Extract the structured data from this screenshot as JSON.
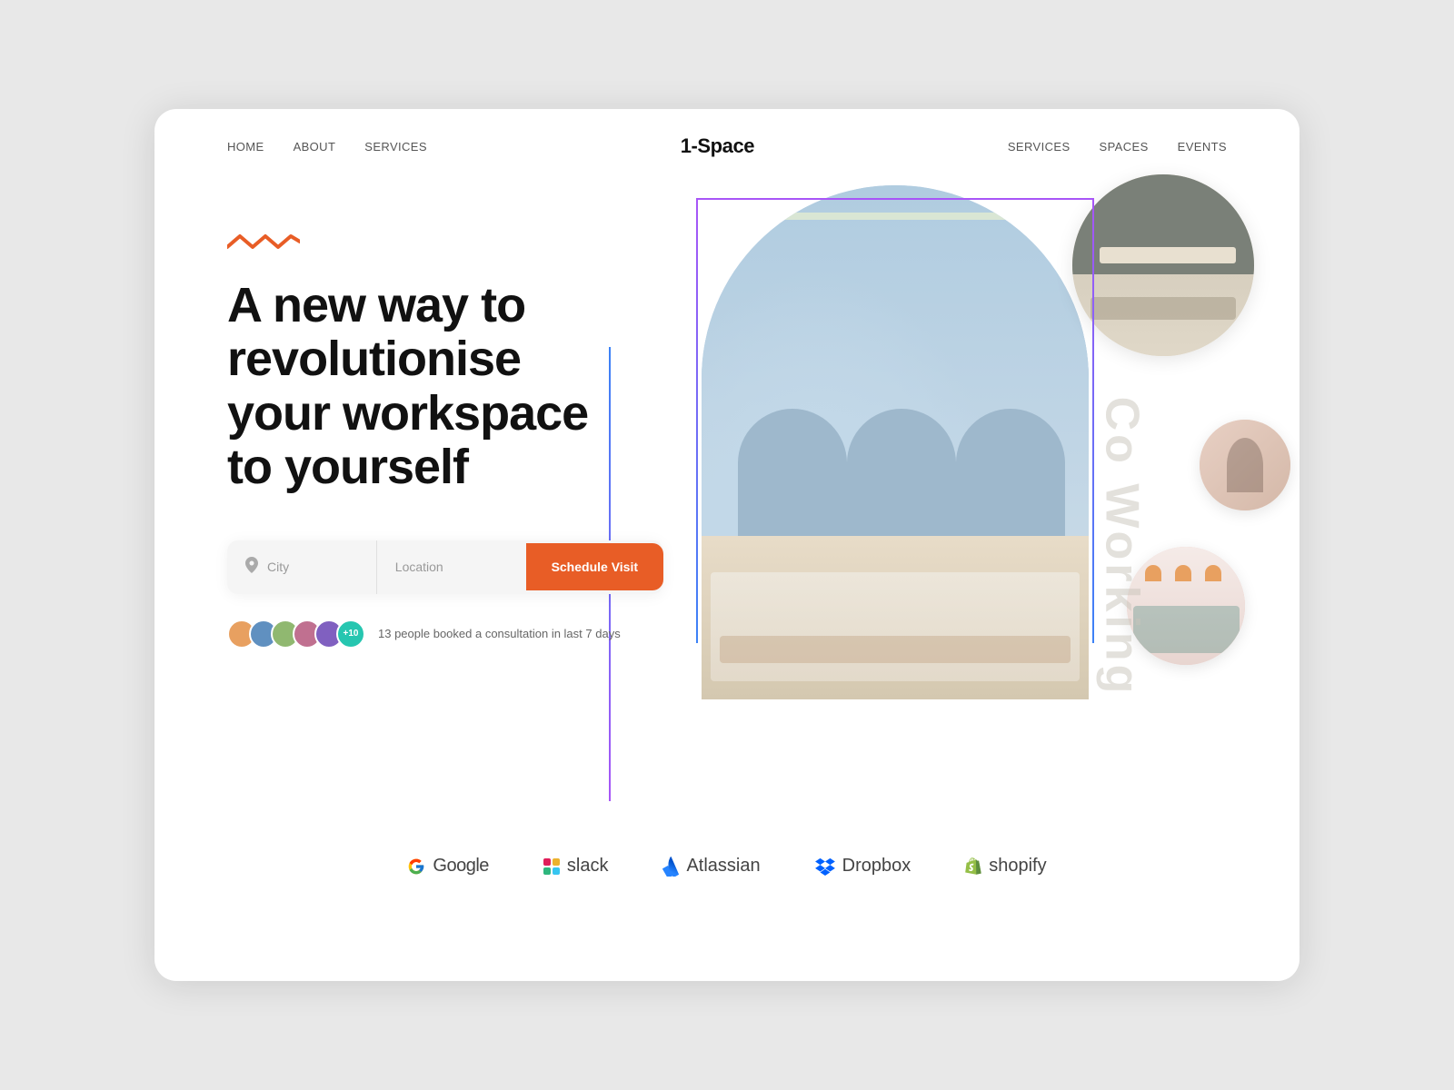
{
  "nav": {
    "left_links": [
      "HOME",
      "ABOUT",
      "SERVICES"
    ],
    "logo": "1-Space",
    "right_links": [
      "SERVICES",
      "SPACES",
      "EVENTS"
    ]
  },
  "hero": {
    "wave_symbol": "∧∧∧∧",
    "title_line1": "A new way to",
    "title_line2": "revolutionise",
    "title_line3": "your workspace",
    "title_line4": "to yourself",
    "search": {
      "city_placeholder": "City",
      "location_placeholder": "Location",
      "button_label": "Schedule Visit"
    },
    "social_proof": {
      "count_badge": "+10",
      "text": "13 people booked a consultation in last 7 days"
    }
  },
  "coworking_label": "Co Working",
  "brands": {
    "items": [
      "Google",
      "slack",
      "Atlassian",
      "Dropbox",
      "shopify"
    ]
  }
}
